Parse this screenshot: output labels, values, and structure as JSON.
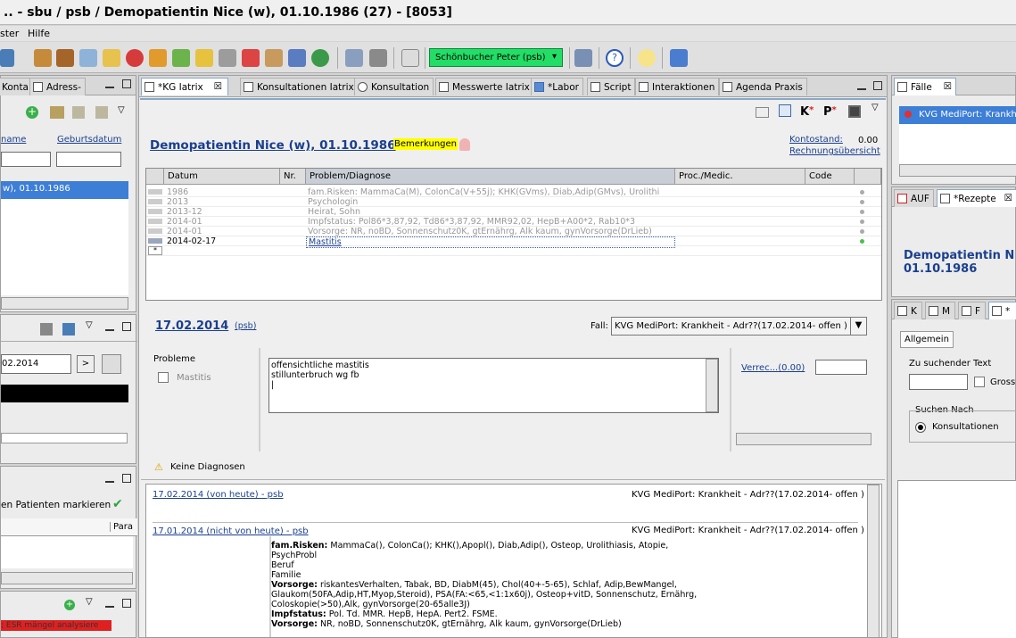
{
  "window": {
    "title": ".. -  sbu / psb  / Demopatientin Nice (w), 01.10.1986 (27) - [8053]"
  },
  "menu": {
    "items": [
      "ster",
      "Hilfe"
    ]
  },
  "toolbar": {
    "user": "Schönbucher Peter (psb)",
    "user_dropdown": "▾"
  },
  "left": {
    "tabs": [
      "Konta",
      "Adress-"
    ],
    "col_name": "name",
    "col_birth": "Geburtsdatum",
    "selected_patient": "w), 01.10.1986",
    "date_value": "02.2014",
    "date_arrow": ">",
    "mark_label": "en Patienten markieren",
    "para_col": "Para",
    "esr_text": "; ESR mängel analysiere"
  },
  "center": {
    "tabs": [
      "*KG Iatrix",
      "Konsultationen Iatrix",
      "Konsultation",
      "Messwerte Iatrix",
      "*Labor",
      "Script",
      "Interaktionen",
      "Agenda Praxis"
    ],
    "patient_title": "Demopatientin Nice (w), 01.10.1986",
    "remarks": "Bemerkungen",
    "account_label": "Kontostand:",
    "account_value": "0.00",
    "invoice_link": "Rechnungsübersicht",
    "columns": [
      "Datum",
      "Nr.",
      "Problem/Diagnose",
      "Proc./Medic.",
      "Code"
    ],
    "rows": [
      {
        "date": "1986",
        "problem": "fam.Risken: MammaCa(M), ColonCa(V+55j); KHK(GVms), Diab,Adip(GMvs), Urolithi"
      },
      {
        "date": "2013",
        "problem": "Psychologin"
      },
      {
        "date": "2013-12",
        "problem": "Heirat, Sohn"
      },
      {
        "date": "2014-01",
        "problem": "Impfstatus: Pol86*3,87,92, Td86*3,87,92, MMR92,02, HepB+A00*2, Rab10*3"
      },
      {
        "date": "2014-01",
        "problem": "Vorsorge: NR, noBD, Sonnenschutz0K, gtErnährg, Alk kaum, gynVorsorge(DrLieb)"
      },
      {
        "date": "2014-02-17",
        "problem": "Mastitis"
      }
    ],
    "new_row": "*",
    "consult_date": "17.02.2014",
    "consult_user": "(psb)",
    "fall_label": "Fall:",
    "fall_value": "KVG MediPort: Krankheit - Adr??(17.02.2014- offen )",
    "problems_label": "Probleme",
    "problem_check": "Mastitis",
    "note_lines": [
      "offensichtliche mastitis",
      "stillunterbruch wg fb",
      "|"
    ],
    "billing_link": "Verrec...(0.00)",
    "no_diag": "Keine Diagnosen",
    "history": [
      {
        "head": "17.02.2014 (von heute) - psb",
        "case": "KVG MediPort: Krankheit - Adr??(17.02.2014- offen )"
      },
      {
        "head": "17.01.2014 (nicht von heute) - psb",
        "case": "KVG MediPort: Krankheit - Adr??(17.02.2014- offen )"
      }
    ],
    "history_text": [
      {
        "b": "fam.Risken:",
        "t": " MammaCa(), ColonCa(); KHK(),Apopl(), Diab,Adip(), Osteop, Urolithiasis, Atopie,"
      },
      {
        "b": "",
        "t": "PsychProbl"
      },
      {
        "b": "",
        "t": "Beruf"
      },
      {
        "b": "",
        "t": "Familie"
      },
      {
        "b": "Vorsorge:",
        "t": " riskantesVerhalten, Tabak, BD, DiabM(45), Chol(40+-5-65), Schlaf, Adip,BewMangel,"
      },
      {
        "b": "",
        "t": "Glaukom(50FA,Adip,HT,Myop,Steroid), PSA(FA:<65,<1:1x60j), Osteop+vitD, Sonnenschutz, Ernährg,"
      },
      {
        "b": "",
        "t": "Coloskopie(>50),Alk, gynVorsorge(20-65alle3J)"
      },
      {
        "b": "Impfstatus:",
        "t": " Pol. Td. MMR. HepB, HepA. Pert2. FSME."
      },
      {
        "b": "Vorsorge:",
        "t": " NR, noBD, Sonnenschutz0K, gtErnährg, Alk kaum, gynVorsorge(DrLieb)"
      }
    ]
  },
  "right": {
    "falle_tab": "Fälle",
    "fall_item": "KVG MediPort: Krankh",
    "auf_tab": "AUF",
    "rezepte_tab": "*Rezepte",
    "patient_name": "Demopatientin N",
    "patient_dob": "01.10.1986",
    "small_tabs": [
      "K",
      "M",
      "F",
      "*"
    ],
    "allgemein": "Allgemein",
    "search_label": "Zu suchender Text",
    "gross_label": "Gross",
    "search_by": "Suchen Nach",
    "radio_label": "Konsultationen"
  },
  "colors": {
    "user_button": "#22dd66",
    "selection": "#3d7ed6",
    "title_blue": "#1a3f8f",
    "remarks_bg": "#ffff00",
    "esr_bg": "#e02020"
  }
}
